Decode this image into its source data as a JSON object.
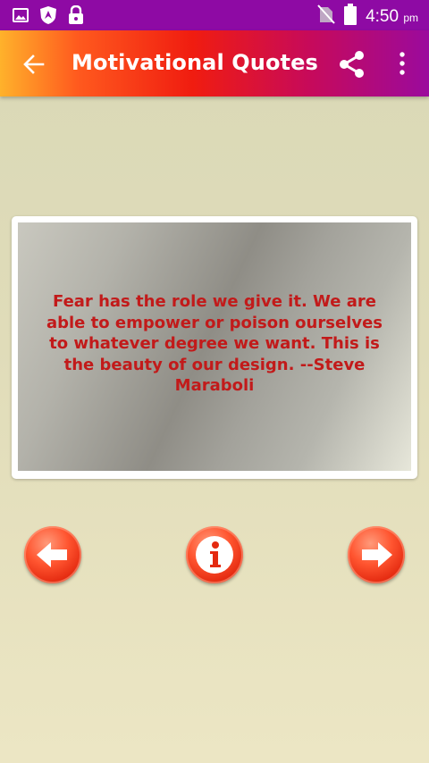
{
  "status_bar": {
    "time": "4:50",
    "ampm": "pm",
    "left_icons": [
      "gallery-icon",
      "shield-icon",
      "lock-icon"
    ],
    "right_icons": [
      "no-sim-icon",
      "battery-icon"
    ]
  },
  "app_bar": {
    "title": "Motivational Quotes",
    "icons": [
      "back-arrow-icon",
      "share-icon",
      "more-vert-icon"
    ]
  },
  "quote": {
    "text": "Fear has the role we give it. We are able to empower or poison ourselves to whatever degree we want. This is the beauty of our design. --Steve Maraboli"
  },
  "controls": {
    "icons": [
      "prev-arrow-icon",
      "info-icon",
      "next-arrow-icon"
    ]
  },
  "colors": {
    "status_bar": "#8e0aa4",
    "quote_text": "#c21a1a",
    "button_red": "#e42a10"
  }
}
